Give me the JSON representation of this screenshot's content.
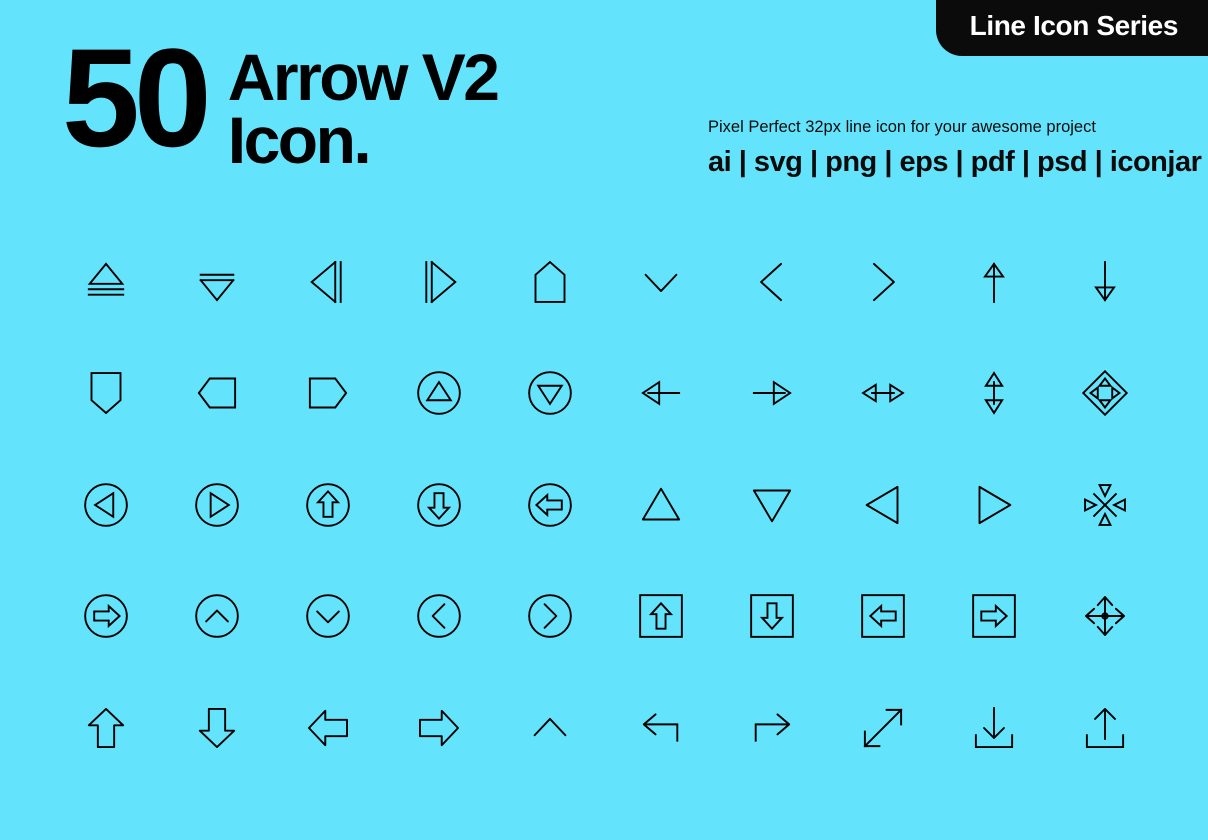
{
  "background_color": "#64e4fc",
  "ink_color": "#000000",
  "badge": {
    "label": "Line Icon Series",
    "bg_color": "#0b0b0b",
    "text_color": "#ffffff"
  },
  "header": {
    "count": "50",
    "title_line1": "Arrow V2",
    "title_line2": "Icon."
  },
  "info": {
    "subtitle": "Pixel Perfect 32px line icon for your awesome project",
    "formats": "ai | svg | png | eps | pdf | psd | iconjar"
  },
  "grid": {
    "columns": 10,
    "rows": 5,
    "icons": [
      {
        "name": "eject-icon",
        "label": "eject"
      },
      {
        "name": "triangle-down-bar-icon",
        "label": "triangle down with bar"
      },
      {
        "name": "triangle-left-bar-icon",
        "label": "triangle left with bar"
      },
      {
        "name": "triangle-right-bar-icon",
        "label": "triangle right with bar"
      },
      {
        "name": "pentagon-up-icon",
        "label": "pentagon up"
      },
      {
        "name": "chevron-down-icon",
        "label": "chevron down"
      },
      {
        "name": "chevron-left-icon",
        "label": "chevron left"
      },
      {
        "name": "chevron-right-icon",
        "label": "chevron right"
      },
      {
        "name": "arrow-up-thin-icon",
        "label": "arrow up thin"
      },
      {
        "name": "arrow-down-thin-icon",
        "label": "arrow down thin"
      },
      {
        "name": "pentagon-down-icon",
        "label": "pentagon down"
      },
      {
        "name": "tag-left-icon",
        "label": "tag left"
      },
      {
        "name": "tag-right-icon",
        "label": "tag right"
      },
      {
        "name": "circle-triangle-up-icon",
        "label": "circle triangle up"
      },
      {
        "name": "circle-triangle-down-icon",
        "label": "circle triangle down"
      },
      {
        "name": "arrow-left-icon",
        "label": "arrow left"
      },
      {
        "name": "arrow-right-icon",
        "label": "arrow right"
      },
      {
        "name": "arrows-horizontal-icon",
        "label": "arrows horizontal"
      },
      {
        "name": "arrows-vertical-icon",
        "label": "arrows vertical"
      },
      {
        "name": "move-diamond-icon",
        "label": "move diamond four way"
      },
      {
        "name": "circle-triangle-left-icon",
        "label": "circle triangle left"
      },
      {
        "name": "circle-triangle-right-icon",
        "label": "circle triangle right"
      },
      {
        "name": "circle-arrow-up-icon",
        "label": "circle arrow up"
      },
      {
        "name": "circle-arrow-down-icon",
        "label": "circle arrow down"
      },
      {
        "name": "circle-arrow-left-icon",
        "label": "circle arrow left"
      },
      {
        "name": "triangle-up-icon",
        "label": "triangle up"
      },
      {
        "name": "triangle-down-icon",
        "label": "triangle down"
      },
      {
        "name": "triangle-left-icon",
        "label": "triangle left"
      },
      {
        "name": "triangle-right-icon",
        "label": "triangle right"
      },
      {
        "name": "collapse-four-way-icon",
        "label": "collapse four way"
      },
      {
        "name": "circle-arrow-right-icon",
        "label": "circle arrow right"
      },
      {
        "name": "circle-chevron-up-icon",
        "label": "circle chevron up"
      },
      {
        "name": "circle-chevron-down-icon",
        "label": "circle chevron down"
      },
      {
        "name": "circle-chevron-left-icon",
        "label": "circle chevron left"
      },
      {
        "name": "circle-chevron-right-icon",
        "label": "circle chevron right"
      },
      {
        "name": "square-arrow-up-icon",
        "label": "square arrow up"
      },
      {
        "name": "square-arrow-down-icon",
        "label": "square arrow down"
      },
      {
        "name": "square-arrow-left-icon",
        "label": "square arrow left"
      },
      {
        "name": "square-arrow-right-icon",
        "label": "square arrow right"
      },
      {
        "name": "move-cross-icon",
        "label": "move cross four way"
      },
      {
        "name": "block-arrow-up-icon",
        "label": "block arrow up"
      },
      {
        "name": "block-arrow-down-icon",
        "label": "block arrow down"
      },
      {
        "name": "block-arrow-left-icon",
        "label": "block arrow left"
      },
      {
        "name": "block-arrow-right-icon",
        "label": "block arrow right"
      },
      {
        "name": "chevron-up-icon",
        "label": "chevron up"
      },
      {
        "name": "arrow-corner-left-icon",
        "label": "arrow turn left"
      },
      {
        "name": "arrow-corner-right-icon",
        "label": "arrow turn right"
      },
      {
        "name": "diagonal-expand-icon",
        "label": "diagonal expand"
      },
      {
        "name": "download-icon",
        "label": "download"
      },
      {
        "name": "upload-icon",
        "label": "upload"
      }
    ]
  }
}
